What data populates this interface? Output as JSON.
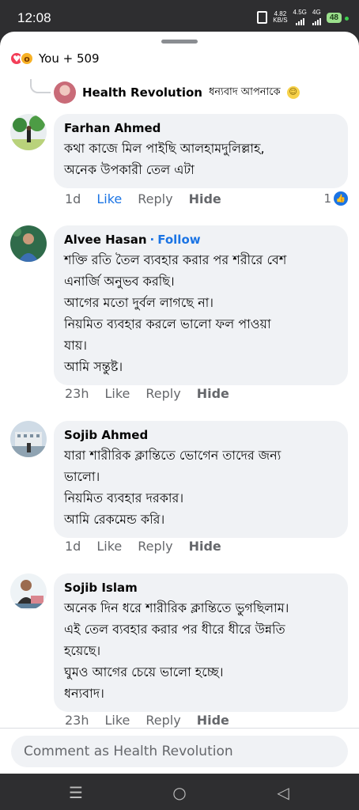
{
  "status_bar": {
    "time": "12:08",
    "net_speed_value": "4.82",
    "net_speed_unit": "KB/S",
    "sig1_label": "4.5G",
    "sig2_label": "4G",
    "battery": "48"
  },
  "reactions": {
    "label": "You + 509",
    "icons": [
      "love-icon",
      "wow-icon"
    ]
  },
  "reply_preview": {
    "author": "Health Revolution",
    "text": "ধন্যবাদ আপনাকে"
  },
  "comments": [
    {
      "author": "Farhan Ahmed",
      "follow": "",
      "lines": [
        "কথা কাজে মিল পাইছি আলহামদুলিল্লাহ,",
        "অনেক উপকারী তেল এটা"
      ],
      "time": "1d",
      "like": "Like",
      "reply": "Reply",
      "hide": "Hide",
      "like_count": "1",
      "liked": true
    },
    {
      "author": "Alvee Hasan",
      "follow": "Follow",
      "lines": [
        "শক্তি রতি তৈল ব্যবহার করার পর শরীরে বেশ",
        "এনার্জি অনুভব করছি।",
        "আগের মতো দুর্বল লাগছে না।",
        "নিয়মিত ব্যবহার করলে ভালো ফল পাওয়া",
        "যায়।",
        "আমি সন্তুষ্ট।"
      ],
      "time": "23h",
      "like": "Like",
      "reply": "Reply",
      "hide": "Hide"
    },
    {
      "author": "Sojib Ahmed",
      "follow": "",
      "lines": [
        "যারা শারীরিক ক্লান্তিতে ভোগেন তাদের জন্য",
        "ভালো।",
        "নিয়মিত ব্যবহার দরকার।",
        "আমি রেকমেন্ড করি।"
      ],
      "time": "1d",
      "like": "Like",
      "reply": "Reply",
      "hide": "Hide"
    },
    {
      "author": "Sojib Islam",
      "follow": "",
      "lines": [
        "অনেক দিন ধরে শারীরিক ক্লান্তিতে ভুগছিলাম।",
        "এই তেল ব্যবহার করার পর ধীরে ধীরে উন্নতি",
        "হয়েছে।",
        "ঘুমও আগের চেয়ে ভালো হচ্ছে।",
        "ধন্যবাদ।"
      ],
      "time": "23h",
      "like": "Like",
      "reply": "Reply",
      "hide": "Hide"
    }
  ],
  "composer": {
    "placeholder": "Comment as Health Revolution"
  },
  "nav": {
    "recent": "☰",
    "home": "○",
    "back": "◁"
  },
  "colors": {
    "accent": "#1b74e4",
    "bubble": "#f0f2f5",
    "muted": "#65676b"
  }
}
